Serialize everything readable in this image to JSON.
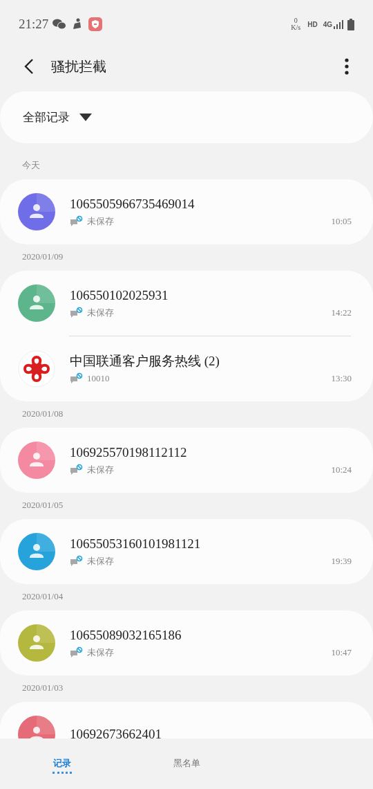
{
  "status_bar": {
    "time": "21:27",
    "speed": "0",
    "speed_unit": "K/s",
    "hd": "HD",
    "network": "4G"
  },
  "header": {
    "title": "骚扰拦截"
  },
  "filter": {
    "label": "全部记录"
  },
  "groups": [
    {
      "date": "今天",
      "entries": [
        {
          "kind": "person",
          "color": "#6f6ee8",
          "name": "1065505966735469014",
          "subtitle": "未保存",
          "time": "10:05"
        }
      ]
    },
    {
      "date": "2020/01/09",
      "entries": [
        {
          "kind": "person",
          "color": "#5db58c",
          "name": "106550102025931",
          "subtitle": "未保存",
          "time": "14:22"
        },
        {
          "kind": "logo",
          "name": "中国联通客户服务热线 (2)",
          "subtitle": "10010",
          "time": "13:30"
        }
      ]
    },
    {
      "date": "2020/01/08",
      "entries": [
        {
          "kind": "person",
          "color": "#f489a2",
          "name": "106925570198112112",
          "subtitle": "未保存",
          "time": "10:24"
        }
      ]
    },
    {
      "date": "2020/01/05",
      "entries": [
        {
          "kind": "person",
          "color": "#27a3dc",
          "name": "10655053160101981121",
          "subtitle": "未保存",
          "time": "19:39"
        }
      ]
    },
    {
      "date": "2020/01/04",
      "entries": [
        {
          "kind": "person",
          "color": "#b5b83e",
          "name": "10655089032165186",
          "subtitle": "未保存",
          "time": "10:47"
        }
      ]
    },
    {
      "date": "2020/01/03",
      "entries": [
        {
          "kind": "person",
          "color": "#e56b78",
          "name": "10692673662401"
        }
      ]
    }
  ],
  "tabs": [
    {
      "label": "记录",
      "selected": true
    },
    {
      "label": "黑名单",
      "selected": false
    }
  ]
}
